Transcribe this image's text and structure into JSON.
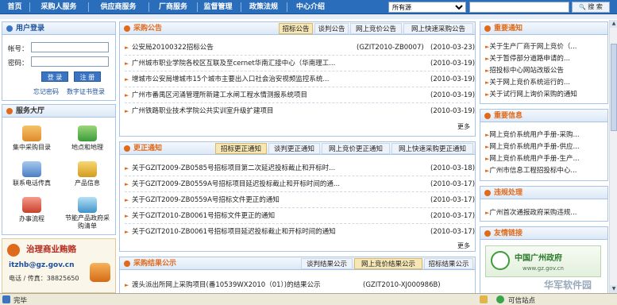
{
  "nav": {
    "items": [
      "首页",
      "采购人服务",
      "供应商服务",
      "厂商服务",
      "监督管理",
      "政策法规",
      "中心介绍"
    ],
    "select_value": "所有源",
    "search_label": "搜 索"
  },
  "login": {
    "title": "用户登录",
    "account_label": "帐号：",
    "password_label": "密码：",
    "login_btn": "登 录",
    "register_btn": "注 册",
    "forgot_link": "忘记密码",
    "cert_link": "数字证书登录"
  },
  "services": {
    "title": "服务大厅",
    "items": [
      {
        "label": "集中采购目录",
        "icon": "catalog-icon"
      },
      {
        "label": "地点和地理",
        "icon": "location-icon"
      },
      {
        "label": "联系电话传真",
        "icon": "phone-icon"
      },
      {
        "label": "产品信息",
        "icon": "product-icon"
      },
      {
        "label": "办事流程",
        "icon": "process-icon"
      },
      {
        "label": "节能产品政府采购清单",
        "icon": "energy-icon"
      }
    ]
  },
  "promo": {
    "title": "治理商业贿赂",
    "email": "itzhb@gz.gov.cn",
    "phone": "电话 / 传真：38825650"
  },
  "announcements": {
    "title": "采购公告",
    "tabs": [
      "招标公告",
      "谈判公告",
      "网上竞价公告",
      "网上快速采购公告"
    ],
    "more": "更多",
    "rows": [
      {
        "title": "公安局20100322招标公告",
        "code": "(GZIT2010-ZB0007)",
        "date": "(2010-03-23)"
      },
      {
        "title": "广州城市职业学院各校区互联及至cernet华南汇接中心（华南理工...",
        "code": "",
        "date": "(2010-03-19)"
      },
      {
        "title": "增城市公安局增城市15个城市主要出入口社会治安视频监控系统...",
        "code": "",
        "date": "(2010-03-19)"
      },
      {
        "title": "广州市番禺区河涌管理所新建工水闸工程水情测报系统项目",
        "code": "",
        "date": "(2010-03-19)"
      },
      {
        "title": "广州铁路职业技术学院公共实训室升级扩建项目",
        "code": "",
        "date": "(2010-03-19)"
      }
    ]
  },
  "changes": {
    "title": "更正通知",
    "tabs": [
      "招标更正通知",
      "谈判更正通知",
      "网上竞价更正通知",
      "网上快速采购更正通知"
    ],
    "more": "更多",
    "rows": [
      {
        "title": "关于GZIT2009-ZB0585号招标项目第二次延迟投标截止和开标时...",
        "date": "(2010-03-18)"
      },
      {
        "title": "关于GZIT2009-ZB0559A号招标项目延迟投标截止和开标时间的通...",
        "date": "(2010-03-17)"
      },
      {
        "title": "关于GZIT2009-ZB0559A号招标文件更正的通知",
        "date": "(2010-03-17)"
      },
      {
        "title": "关于GZIT2010-ZB0061号招标文件更正的通知",
        "date": "(2010-03-17)"
      },
      {
        "title": "关于GZIT2010-ZB0061号招标项目延迟投标截止和开标时间的通知",
        "date": "(2010-03-17)"
      }
    ]
  },
  "results": {
    "title": "采购结果公示",
    "tabs": [
      "谈判结果公示",
      "网上竞价结果公示",
      "招标结果公示"
    ],
    "rows": [
      {
        "title": "渡头派出所网上采购项目(番10539WX2010（01）)的结果公示",
        "code": "(GZIT2010-XJ000986B)"
      }
    ]
  },
  "notices": {
    "title": "重要通知",
    "items": [
      "关于生产厂商于网上竞价（...",
      "关于暂停部分道路申请的...",
      "招投标中心网站改版公告",
      "关于网上竞价系统运行的...",
      "关于试行网上询价采购的通知"
    ]
  },
  "info": {
    "title": "重要信息",
    "items": [
      "网上竞价系统用户手册-采购...",
      "网上竞价系统用户手册-供应...",
      "网上竞价系统用户手册-生产...",
      "广州市信息工程招投标中心..."
    ]
  },
  "violations": {
    "title": "违规处理",
    "items": [
      "广州首次通报政府采购违规..."
    ]
  },
  "links": {
    "title": "友情链接",
    "gov_name": "中国广州政府",
    "gov_sub": "www.gz.gov.cn",
    "watermark": "华军软件园"
  },
  "status": {
    "left": "完毕",
    "right": "可信站点"
  },
  "colors": {
    "nav": "#2a6dbb",
    "accent": "#e06a1b",
    "tab_active": "#f6e7b5"
  }
}
